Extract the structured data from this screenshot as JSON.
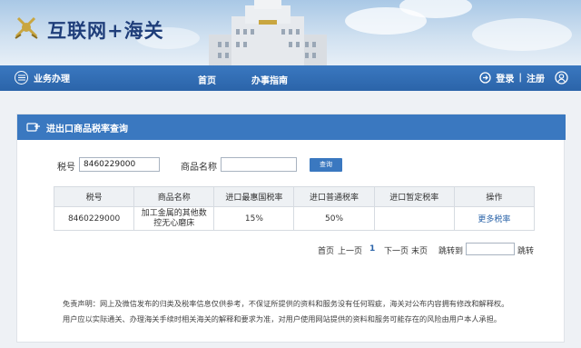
{
  "site": {
    "title": "互联网+海关"
  },
  "nav": {
    "menu_label": "业务办理",
    "items": [
      {
        "label": "首页"
      },
      {
        "label": "办事指南"
      }
    ],
    "login": "登录",
    "separator": "|",
    "register": "注册"
  },
  "panel": {
    "title": "进出口商品税率查询"
  },
  "form": {
    "tax_code_label": "税号",
    "tax_code_value": "8460229000",
    "product_name_label": "商品名称",
    "product_name_value": "",
    "query_button": "查询"
  },
  "table": {
    "headers": [
      "税号",
      "商品名称",
      "进口最惠国税率",
      "进口普通税率",
      "进口暂定税率",
      "操作"
    ],
    "rows": [
      {
        "tax_code": "8460229000",
        "product_name": "加工金属的其他数控无心磨床",
        "mfn_rate": "15%",
        "general_rate": "50%",
        "provisional_rate": "",
        "action": "更多税率"
      }
    ]
  },
  "pagination": {
    "first": "首页",
    "prev": "上一页",
    "current": "1",
    "next": "下一页",
    "last": "末页",
    "jump_to": "跳转到",
    "jump": "跳转"
  },
  "disclaimer": {
    "line1": "免责声明：网上及微信发布的归类及税率信息仅供参考，不保证所提供的资料和服务没有任何瑕疵，海关对公布内容拥有修改和解释权。",
    "line2": "用户应以实际通关、办理海关手续时相关海关的解释和要求为准，对用户使用网站提供的资料和服务可能存在的风险由用户本人承担。"
  },
  "colors": {
    "nav_blue": "#2b64a9",
    "accent_blue": "#3a78c0",
    "logo_gold": "#c9a640",
    "title_navy": "#1f3e7a"
  },
  "icons": [
    "customs-emblem-icon",
    "menu-circle-icon",
    "login-icon",
    "user-icon",
    "calculator-icon"
  ]
}
